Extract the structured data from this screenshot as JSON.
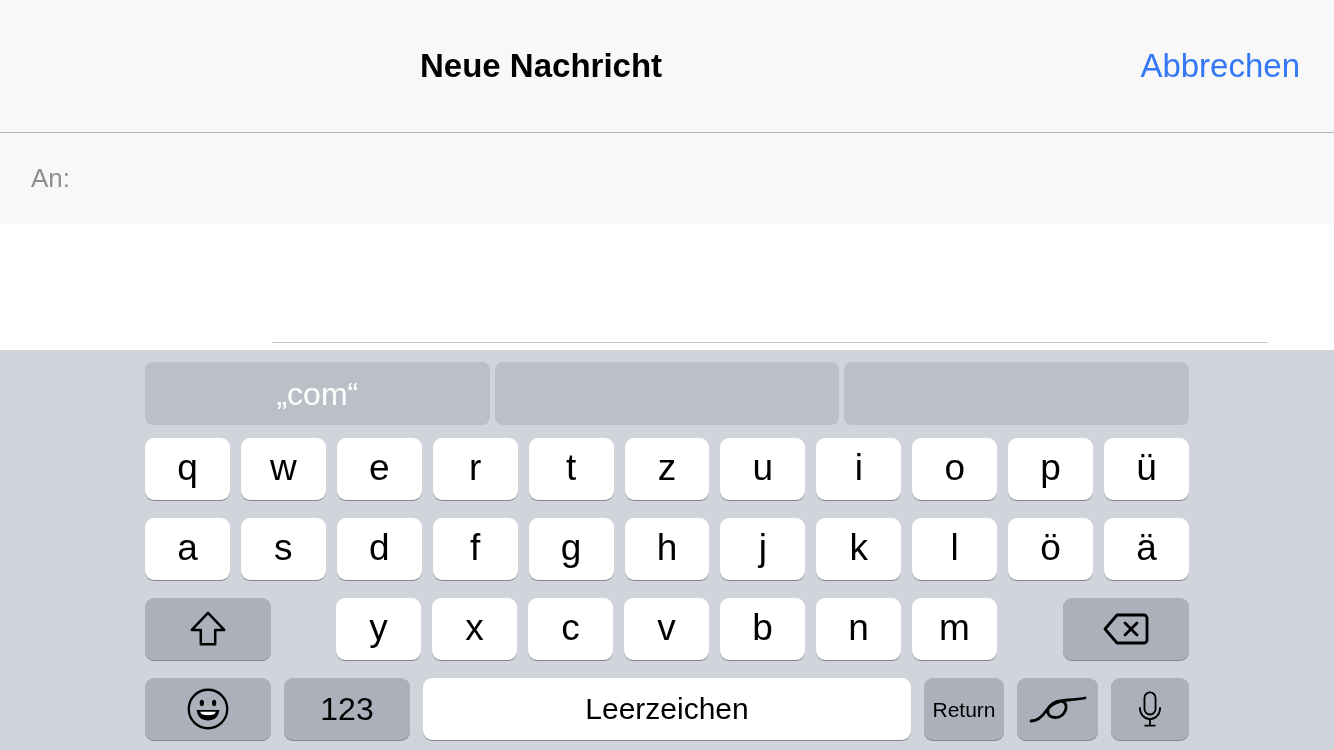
{
  "header": {
    "title": "Neue Nachricht",
    "cancel": "Abbrechen"
  },
  "recipient": {
    "label": "An:"
  },
  "keyboard": {
    "suggestions": [
      "„com“"
    ],
    "rows": [
      {
        "keys": [
          {
            "kind": "letter",
            "label": "q"
          },
          {
            "kind": "letter",
            "label": "w"
          },
          {
            "kind": "letter",
            "label": "e"
          },
          {
            "kind": "letter",
            "label": "r"
          },
          {
            "kind": "letter",
            "label": "t"
          },
          {
            "kind": "letter",
            "label": "z"
          },
          {
            "kind": "letter",
            "label": "u"
          },
          {
            "kind": "letter",
            "label": "i"
          },
          {
            "kind": "letter",
            "label": "o"
          },
          {
            "kind": "letter",
            "label": "p"
          },
          {
            "kind": "letter",
            "label": "ü"
          }
        ]
      },
      {
        "keys": [
          {
            "kind": "letter",
            "label": "a"
          },
          {
            "kind": "letter",
            "label": "s"
          },
          {
            "kind": "letter",
            "label": "d"
          },
          {
            "kind": "letter",
            "label": "f"
          },
          {
            "kind": "letter",
            "label": "g"
          },
          {
            "kind": "letter",
            "label": "h"
          },
          {
            "kind": "letter",
            "label": "j"
          },
          {
            "kind": "letter",
            "label": "k"
          },
          {
            "kind": "letter",
            "label": "l"
          },
          {
            "kind": "letter",
            "label": "ö"
          },
          {
            "kind": "letter",
            "label": "ä"
          }
        ]
      },
      {
        "keys": [
          {
            "kind": "shift"
          },
          {
            "kind": "letter",
            "label": "y"
          },
          {
            "kind": "letter",
            "label": "x"
          },
          {
            "kind": "letter",
            "label": "c"
          },
          {
            "kind": "letter",
            "label": "v"
          },
          {
            "kind": "letter",
            "label": "b"
          },
          {
            "kind": "letter",
            "label": "n"
          },
          {
            "kind": "letter",
            "label": "m"
          },
          {
            "kind": "delete"
          }
        ]
      },
      {
        "keys": [
          {
            "kind": "emoji"
          },
          {
            "kind": "numbers",
            "label": "123"
          },
          {
            "kind": "space",
            "label": "Leerzeichen"
          },
          {
            "kind": "return",
            "label": "Return"
          },
          {
            "kind": "handwriting"
          },
          {
            "kind": "dictation"
          }
        ]
      }
    ]
  }
}
